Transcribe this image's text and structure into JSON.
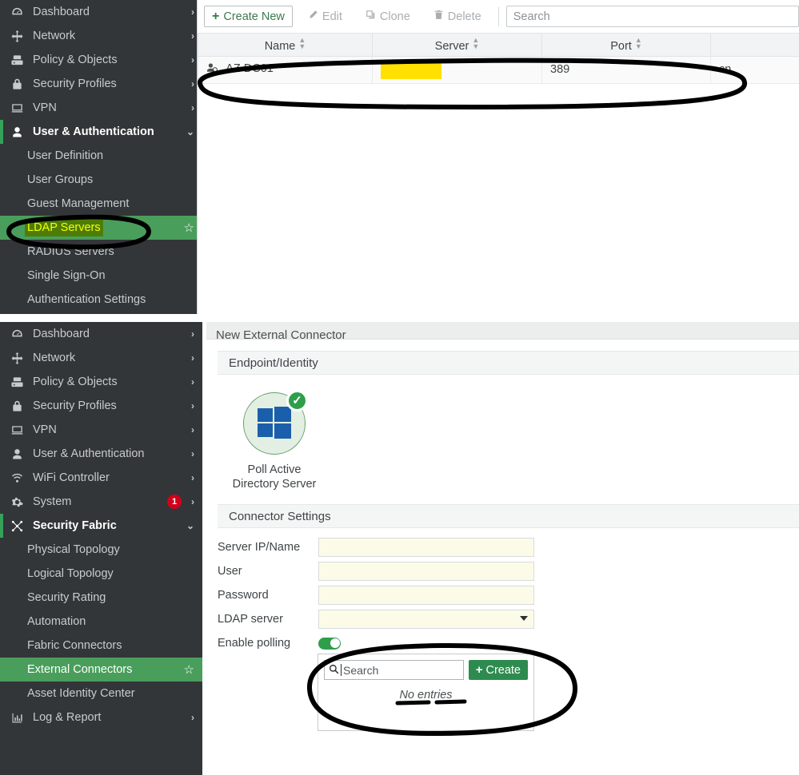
{
  "panel_top": {
    "sidebar": {
      "items": [
        {
          "label": "Dashboard",
          "icon": "dashboard-icon",
          "chevron": "right",
          "state": "collapsed"
        },
        {
          "label": "Network",
          "icon": "network-icon",
          "chevron": "right",
          "state": "collapsed"
        },
        {
          "label": "Policy & Objects",
          "icon": "policy-icon",
          "chevron": "right",
          "state": "collapsed"
        },
        {
          "label": "Security Profiles",
          "icon": "lock-icon",
          "chevron": "right",
          "state": "collapsed"
        },
        {
          "label": "VPN",
          "icon": "monitor-icon",
          "chevron": "right",
          "state": "collapsed"
        },
        {
          "label": "User & Authentication",
          "icon": "user-icon",
          "chevron": "down",
          "state": "expanded"
        }
      ],
      "sub_items": [
        {
          "label": "User Definition",
          "selected": false
        },
        {
          "label": "User Groups",
          "selected": false
        },
        {
          "label": "Guest Management",
          "selected": false
        },
        {
          "label": "LDAP Servers",
          "selected": true,
          "marker_highlight": true,
          "star": "☆"
        },
        {
          "label": "RADIUS Servers",
          "selected": false
        },
        {
          "label": "Single Sign-On",
          "selected": false
        },
        {
          "label": "Authentication Settings",
          "selected": false
        }
      ]
    },
    "toolbar": {
      "create_label": "Create New",
      "create_plus": "+",
      "edit_label": "Edit",
      "clone_label": "Clone",
      "delete_label": "Delete",
      "search_placeholder": "Search"
    },
    "table": {
      "columns": [
        "Name",
        "Server",
        "Port",
        ""
      ],
      "rows": [
        {
          "name": "AZ DC01",
          "server": "",
          "server_redacted": true,
          "port": "389",
          "cnid": "cn"
        }
      ]
    }
  },
  "panel_bottom": {
    "sidebar": {
      "items": [
        {
          "label": "Dashboard",
          "icon": "dashboard-icon",
          "chevron": "right",
          "state": "collapsed"
        },
        {
          "label": "Network",
          "icon": "network-icon",
          "chevron": "right",
          "state": "collapsed"
        },
        {
          "label": "Policy & Objects",
          "icon": "policy-icon",
          "chevron": "right",
          "state": "collapsed"
        },
        {
          "label": "Security Profiles",
          "icon": "lock-icon",
          "chevron": "right",
          "state": "collapsed"
        },
        {
          "label": "VPN",
          "icon": "monitor-icon",
          "chevron": "right",
          "state": "collapsed"
        },
        {
          "label": "User & Authentication",
          "icon": "user-icon",
          "chevron": "right",
          "state": "collapsed"
        },
        {
          "label": "WiFi Controller",
          "icon": "wifi-icon",
          "chevron": "right",
          "state": "collapsed"
        },
        {
          "label": "System",
          "icon": "gear-icon",
          "chevron": "right",
          "state": "collapsed",
          "badge": "1"
        },
        {
          "label": "Security Fabric",
          "icon": "fabric-icon",
          "chevron": "down",
          "state": "expanded"
        }
      ],
      "sub_items": [
        {
          "label": "Physical Topology",
          "selected": false
        },
        {
          "label": "Logical Topology",
          "selected": false
        },
        {
          "label": "Security Rating",
          "selected": false
        },
        {
          "label": "Automation",
          "selected": false
        },
        {
          "label": "Fabric Connectors",
          "selected": false
        },
        {
          "label": "External Connectors",
          "selected": true,
          "star": "☆"
        },
        {
          "label": "Asset Identity Center",
          "selected": false
        }
      ],
      "trailing_items": [
        {
          "label": "Log & Report",
          "icon": "chart-icon",
          "chevron": "right",
          "state": "collapsed"
        }
      ]
    },
    "form": {
      "title": "New External Connector",
      "sections": {
        "endpoint": {
          "heading": "Endpoint/Identity",
          "tile": {
            "label": "Poll Active Directory Server",
            "icon": "windows-logo-icon",
            "badge_icon": "check-circle-icon",
            "selected": true
          }
        },
        "connector_settings": {
          "heading": "Connector Settings",
          "fields": [
            {
              "label": "Server IP/Name",
              "value": "",
              "type": "text"
            },
            {
              "label": "User",
              "value": "",
              "type": "text"
            },
            {
              "label": "Password",
              "value": "",
              "type": "password"
            },
            {
              "label": "LDAP server",
              "value": "",
              "type": "select"
            },
            {
              "label": "Enable polling",
              "value": "on",
              "type": "toggle"
            }
          ]
        }
      }
    },
    "dropdown": {
      "search_placeholder": "Search",
      "search_icon": "search-icon",
      "create_label": "Create",
      "create_plus": "+",
      "empty_text": "No entries"
    }
  },
  "colors": {
    "sidebar_bg": "#333638",
    "selected_green": "#4a9e5c",
    "accent_green": "#2e8b4f",
    "marker_green": "#4e7d07",
    "marker_text_yellow": "#f6ff00",
    "redaction_yellow": "#ffe000",
    "badge_red": "#d0021b",
    "annotation_black": "#000000",
    "field_bg": "#fbfbe8"
  }
}
